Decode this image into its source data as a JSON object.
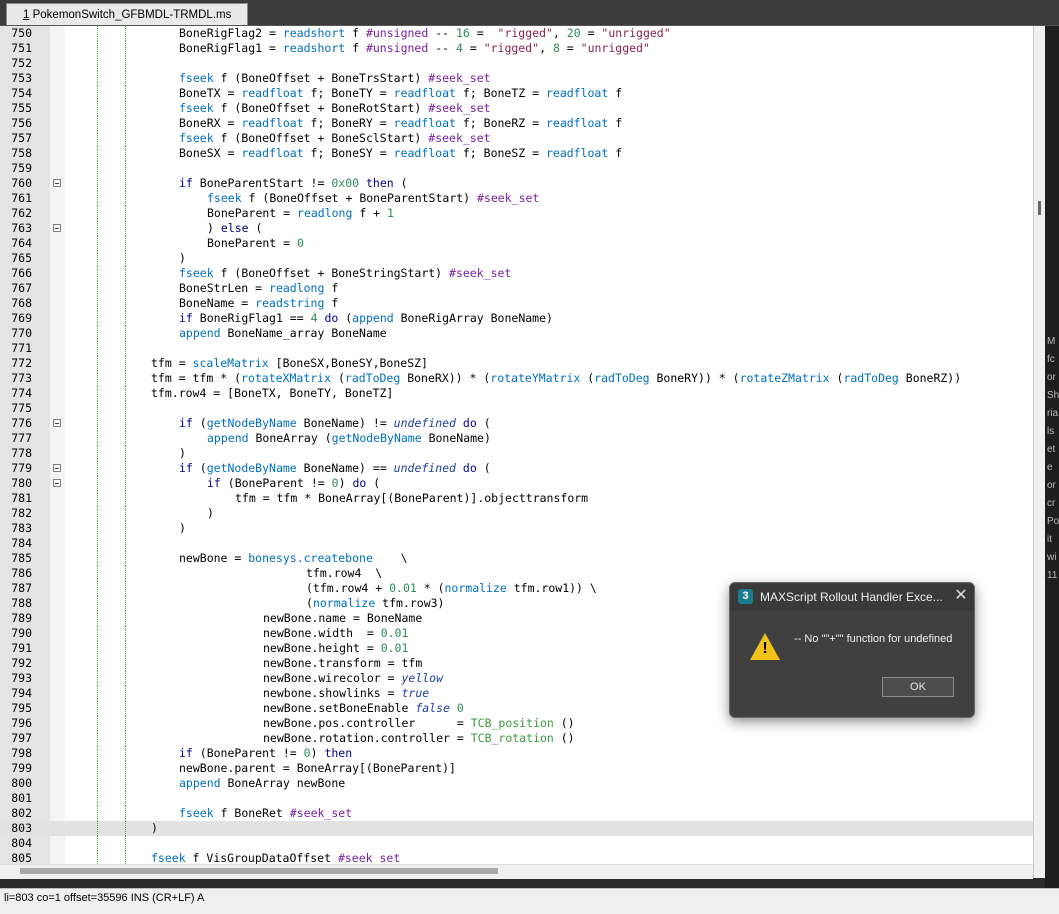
{
  "tab": {
    "number": "1",
    "filename": "PokemonSwitch_GFBMDL-TRMDL.ms"
  },
  "editor": {
    "lines": [
      {
        "num": "750",
        "text": "BoneRigFlag2 = readshort f #unsigned -- 16 =  \"rigged\", 20 = \"unrigged\""
      },
      {
        "num": "751",
        "text": "BoneRigFlag1 = readshort f #unsigned -- 4 = \"rigged\", 8 = \"unrigged\""
      },
      {
        "num": "752",
        "text": ""
      },
      {
        "num": "753",
        "text": "fseek f (BoneOffset + BoneTrsStart) #seek_set"
      },
      {
        "num": "754",
        "text": "BoneTX = readfloat f; BoneTY = readfloat f; BoneTZ = readfloat f"
      },
      {
        "num": "755",
        "text": "fseek f (BoneOffset + BoneRotStart) #seek_set"
      },
      {
        "num": "756",
        "text": "BoneRX = readfloat f; BoneRY = readfloat f; BoneRZ = readfloat f"
      },
      {
        "num": "757",
        "text": "fseek f (BoneOffset + BoneSclStart) #seek_set"
      },
      {
        "num": "758",
        "text": "BoneSX = readfloat f; BoneSY = readfloat f; BoneSZ = readfloat f"
      },
      {
        "num": "759",
        "text": ""
      },
      {
        "num": "760",
        "text": "if BoneParentStart != 0x00 then ("
      },
      {
        "num": "761",
        "text": "    fseek f (BoneOffset + BoneParentStart) #seek_set"
      },
      {
        "num": "762",
        "text": "    BoneParent = readlong f + 1"
      },
      {
        "num": "763",
        "text": "    ) else ("
      },
      {
        "num": "764",
        "text": "    BoneParent = 0"
      },
      {
        "num": "765",
        "text": ")"
      },
      {
        "num": "766",
        "text": "fseek f (BoneOffset + BoneStringStart) #seek_set"
      },
      {
        "num": "767",
        "text": "BoneStrLen = readlong f"
      },
      {
        "num": "768",
        "text": "BoneName = readstring f"
      },
      {
        "num": "769",
        "text": "if BoneRigFlag1 == 4 do (append BoneRigArray BoneName)"
      },
      {
        "num": "770",
        "text": "append BoneName_array BoneName"
      },
      {
        "num": "771",
        "text": ""
      },
      {
        "num": "772",
        "text": "tfm = scaleMatrix [BoneSX,BoneSY,BoneSZ]"
      },
      {
        "num": "773",
        "text": "tfm = tfm * (rotateXMatrix (radToDeg BoneRX)) * (rotateYMatrix (radToDeg BoneRY)) * (rotateZMatrix (radToDeg BoneRZ))"
      },
      {
        "num": "774",
        "text": "tfm.row4 = [BoneTX, BoneTY, BoneTZ]"
      },
      {
        "num": "775",
        "text": ""
      },
      {
        "num": "776",
        "text": "if (getNodeByName BoneName) != undefined do ("
      },
      {
        "num": "777",
        "text": "    append BoneArray (getNodeByName BoneName)"
      },
      {
        "num": "778",
        "text": ")"
      },
      {
        "num": "779",
        "text": "if (getNodeByName BoneName) == undefined do ("
      },
      {
        "num": "780",
        "text": "    if (BoneParent != 0) do ("
      },
      {
        "num": "781",
        "text": "        tfm = tfm * BoneArray[(BoneParent)].objecttransform"
      },
      {
        "num": "782",
        "text": "    )"
      },
      {
        "num": "783",
        "text": ")"
      },
      {
        "num": "784",
        "text": ""
      },
      {
        "num": "785",
        "text": "newBone = bonesys.createbone    \\"
      },
      {
        "num": "786",
        "text": "              tfm.row4  \\"
      },
      {
        "num": "787",
        "text": "              (tfm.row4 + 0.01 * (normalize tfm.row1)) \\"
      },
      {
        "num": "788",
        "text": "              (normalize tfm.row3)"
      },
      {
        "num": "789",
        "text": "        newBone.name = BoneName"
      },
      {
        "num": "790",
        "text": "        newBone.width  = 0.01"
      },
      {
        "num": "791",
        "text": "        newBone.height = 0.01"
      },
      {
        "num": "792",
        "text": "        newBone.transform = tfm"
      },
      {
        "num": "793",
        "text": "        newBone.wirecolor = yellow"
      },
      {
        "num": "794",
        "text": "        newbone.showlinks = true"
      },
      {
        "num": "795",
        "text": "        newBone.setBoneEnable false 0"
      },
      {
        "num": "796",
        "text": "        newBone.pos.controller      = TCB_position ()"
      },
      {
        "num": "797",
        "text": "        newBone.rotation.controller = TCB_rotation ()"
      },
      {
        "num": "798",
        "text": "if (BoneParent != 0) then"
      },
      {
        "num": "799",
        "text": "newBone.parent = BoneArray[(BoneParent)]"
      },
      {
        "num": "800",
        "text": "append BoneArray newBone"
      },
      {
        "num": "801",
        "text": ""
      },
      {
        "num": "802",
        "text": "fseek f BoneRet #seek_set"
      },
      {
        "num": "803",
        "text": ")"
      },
      {
        "num": "804",
        "text": ""
      },
      {
        "num": "805",
        "text": "fseek f VisGroupDataOffset #seek_set"
      }
    ]
  },
  "statusbar": {
    "text": "li=803 co=1 offset=35596 INS (CR+LF) A"
  },
  "dialog": {
    "title": "MAXScript Rollout Handler Exce...",
    "message": "-- No \"\"+\"\" function for undefined",
    "ok_label": "OK",
    "close_glyph": "✕",
    "app_icon_label": "3",
    "warning_glyph": "!"
  },
  "right_panel_fragments": [
    "M",
    "fc",
    "or",
    "Sh",
    "ria",
    "ls",
    "et",
    "e",
    "or",
    "cr",
    "Po",
    "it",
    "wi",
    "11"
  ],
  "colors": {
    "keyword": "#00008b",
    "function": "#0070c0",
    "string": "#8b2252",
    "number": "#2e8b57",
    "symbol": "#7b1fa2",
    "warning_icon": "#f2c318",
    "dialog_bg": "#404040"
  }
}
